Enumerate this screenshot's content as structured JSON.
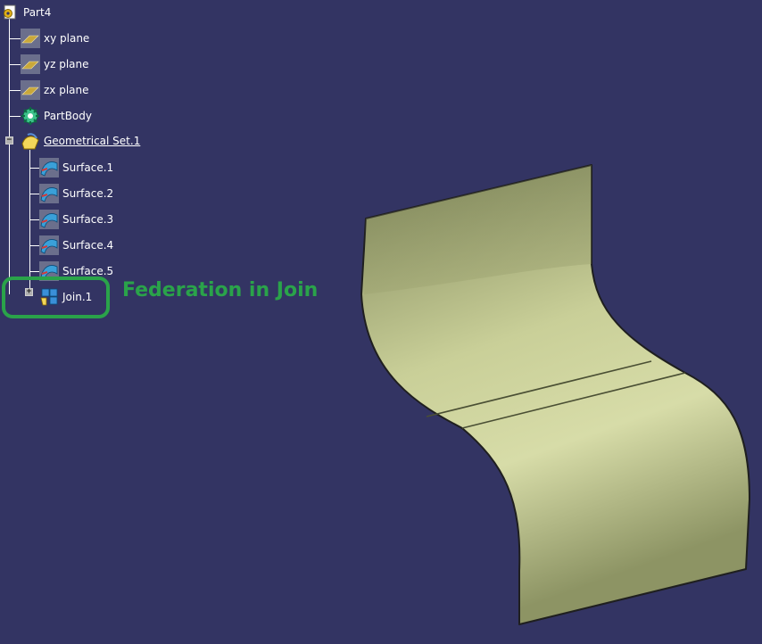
{
  "colors": {
    "background": "#333463",
    "tree_line": "#ffffff",
    "callout": "#2aa34a",
    "surface_fill": "#bcc48a",
    "surface_edge": "#1f1f1f"
  },
  "tree": {
    "root": {
      "label": "Part4",
      "icon": "part-gear-icon"
    },
    "planes": [
      {
        "label": "xy plane",
        "icon": "plane-icon"
      },
      {
        "label": "yz plane",
        "icon": "plane-icon"
      },
      {
        "label": "zx plane",
        "icon": "plane-icon"
      }
    ],
    "part_body": {
      "label": "PartBody",
      "icon": "partbody-gear-icon"
    },
    "geometrical_set": {
      "label": "Geometrical Set.1",
      "icon": "geometrical-set-icon",
      "expanded": true
    },
    "surfaces": [
      {
        "label": "Surface.1",
        "icon": "surface-icon"
      },
      {
        "label": "Surface.2",
        "icon": "surface-icon"
      },
      {
        "label": "Surface.3",
        "icon": "surface-icon"
      },
      {
        "label": "Surface.4",
        "icon": "surface-icon"
      },
      {
        "label": "Surface.5",
        "icon": "surface-icon"
      }
    ],
    "join": {
      "label": "Join.1",
      "icon": "join-icon",
      "expanded": false
    }
  },
  "annotation": {
    "text": "Federation in Join"
  }
}
